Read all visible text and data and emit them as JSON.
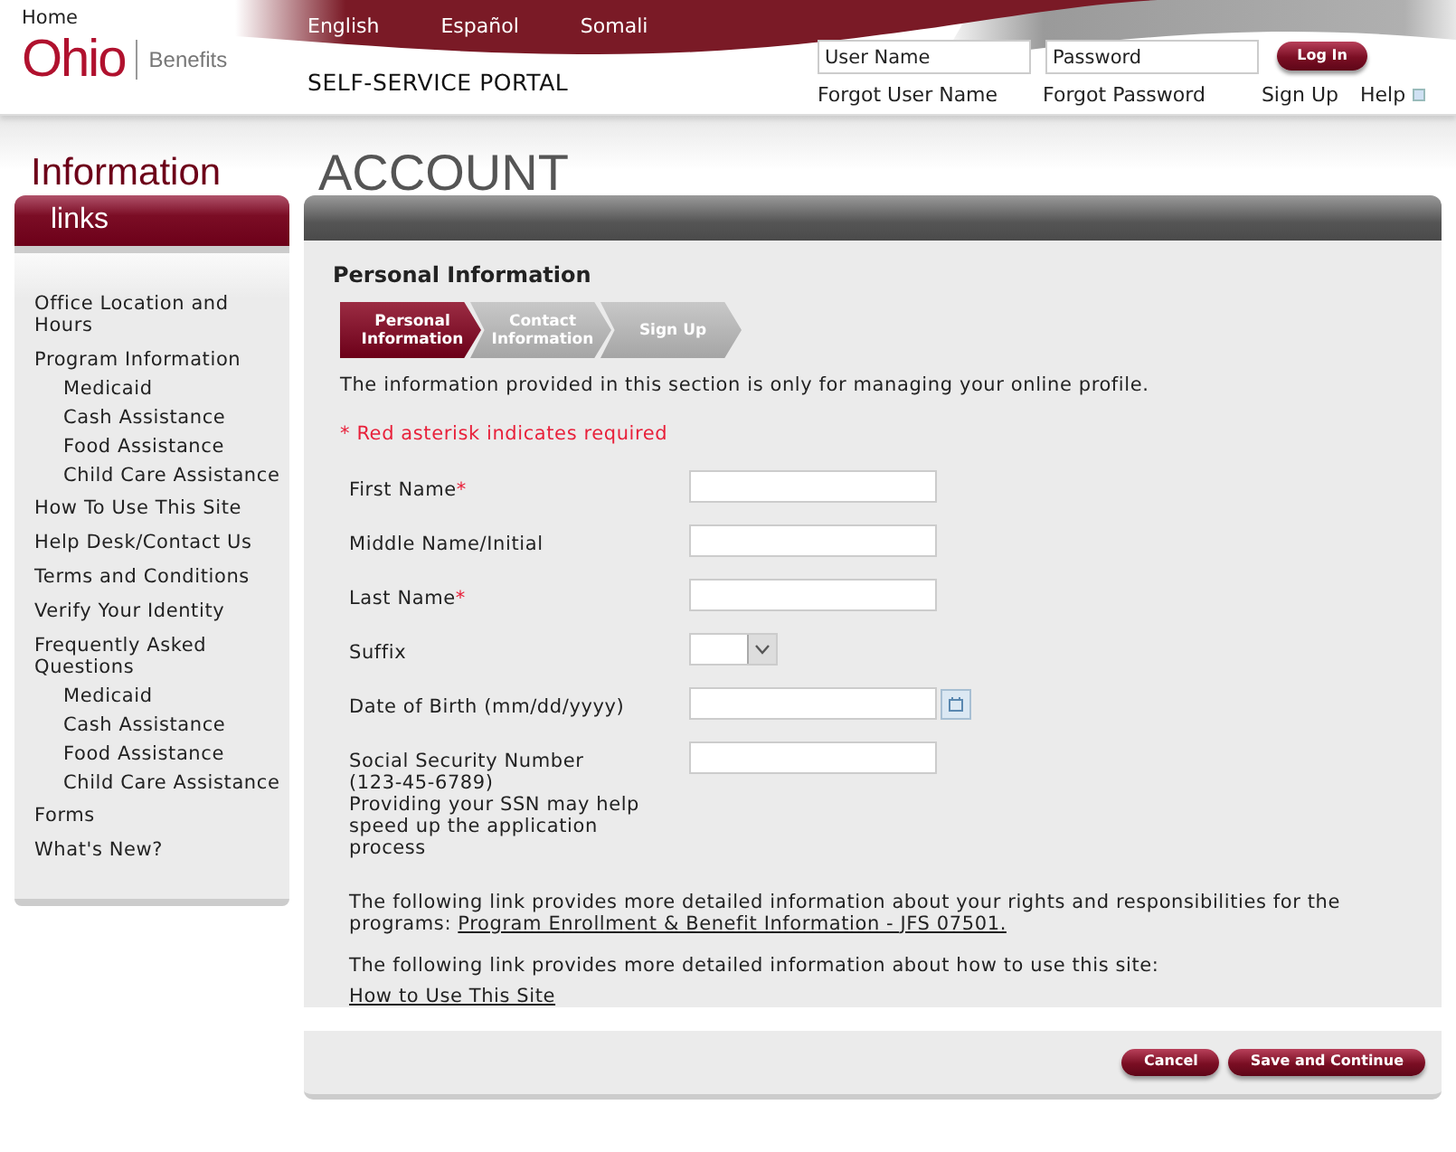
{
  "header": {
    "home_link": "Home",
    "logo": {
      "name": "Ohio",
      "sub": "Benefits"
    },
    "languages": [
      "English",
      "Español",
      "Somali"
    ],
    "portal_title": "SELF-SERVICE PORTAL",
    "login": {
      "username_placeholder": "User Name",
      "password_placeholder": "Password",
      "button": "Log In"
    },
    "links": [
      {
        "label": "Forgot User Name",
        "icon": false
      },
      {
        "label": "Forgot Password",
        "icon": false
      },
      {
        "label": "Sign Up",
        "icon": false
      },
      {
        "label": "Help",
        "icon": true
      }
    ]
  },
  "sidebar": {
    "title": "Information",
    "tab": "links",
    "items": [
      {
        "label": "Office Location and Hours"
      },
      {
        "label": "Program Information",
        "children": [
          {
            "label": "Medicaid"
          },
          {
            "label": "Cash Assistance"
          },
          {
            "label": "Food Assistance"
          },
          {
            "label": "Child Care Assistance"
          }
        ]
      },
      {
        "label": "How To Use This Site"
      },
      {
        "label": "Help Desk/Contact Us"
      },
      {
        "label": "Terms and Conditions"
      },
      {
        "label": "Verify Your Identity"
      },
      {
        "label": "Frequently Asked Questions",
        "children": [
          {
            "label": "Medicaid"
          },
          {
            "label": "Cash Assistance"
          },
          {
            "label": "Food Assistance"
          },
          {
            "label": "Child Care Assistance"
          }
        ]
      },
      {
        "label": "Forms"
      },
      {
        "label": "What's New?"
      }
    ]
  },
  "main": {
    "page_title": "ACCOUNT",
    "section_title": "Personal Information",
    "steps": [
      {
        "label": "Personal Information",
        "selected": true
      },
      {
        "label": "Contact Information",
        "selected": false
      },
      {
        "label": "Sign Up",
        "selected": false
      }
    ],
    "intro": "The information provided in this section is only for managing your online profile.",
    "required_note": "* Red asterisk indicates required",
    "fields": [
      {
        "label": "First Name",
        "required_mark": "*",
        "kind": "text"
      },
      {
        "label": "Middle Name/Initial",
        "kind": "text"
      },
      {
        "label": "Last Name",
        "required_mark": "*",
        "kind": "text"
      },
      {
        "label": "Suffix",
        "kind": "select"
      },
      {
        "label": "Date of Birth (mm/dd/yyyy)",
        "kind": "date"
      },
      {
        "label": "Social Security Number (123-45-6789)",
        "note": "Providing your SSN may help speed up the application process",
        "kind": "text"
      }
    ],
    "info": [
      {
        "text": "The following link provides more detailed information about your rights and responsibilities for the programs:",
        "link": "Program Enrollment & Benefit Information - JFS 07501.",
        "kind": "inline"
      },
      {
        "text": "The following link provides more detailed information about how to use this site:",
        "link": "How to Use This Site",
        "kind": "block"
      }
    ],
    "buttons": [
      "Cancel",
      "Save and Continue"
    ]
  }
}
